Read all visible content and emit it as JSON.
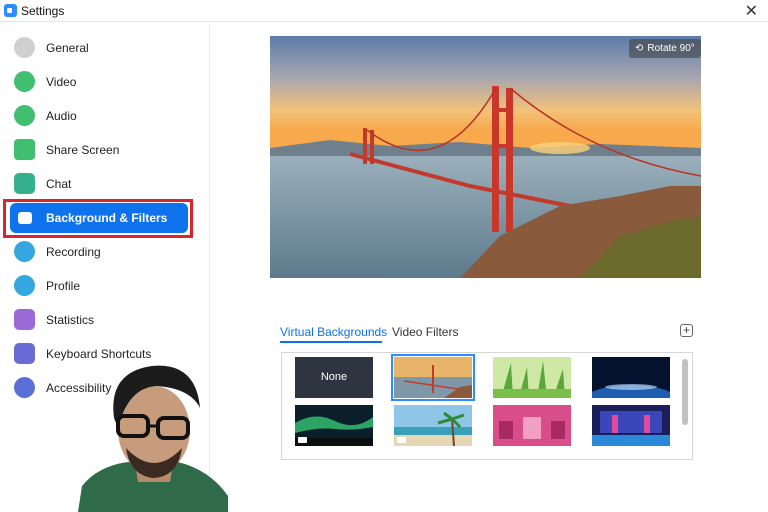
{
  "window": {
    "title": "Settings",
    "close_glyph": "✕"
  },
  "sidebar": {
    "items": [
      {
        "label": "General",
        "icon": "gear-icon",
        "color": "#c9c9c9"
      },
      {
        "label": "Video",
        "icon": "video-camera-icon",
        "color": "#3fbf6f"
      },
      {
        "label": "Audio",
        "icon": "headphones-icon",
        "color": "#3fbf6f"
      },
      {
        "label": "Share Screen",
        "icon": "share-screen-icon",
        "color": "#3fbf6f"
      },
      {
        "label": "Chat",
        "icon": "chat-icon",
        "color": "#34b08c"
      },
      {
        "label": "Background & Filters",
        "icon": "background-icon",
        "color": "#0e72ed",
        "active": true
      },
      {
        "label": "Recording",
        "icon": "record-icon",
        "color": "#35a7e0"
      },
      {
        "label": "Profile",
        "icon": "profile-icon",
        "color": "#35a7e0"
      },
      {
        "label": "Statistics",
        "icon": "statistics-icon",
        "color": "#9a6bd6"
      },
      {
        "label": "Keyboard Shortcuts",
        "icon": "keyboard-icon",
        "color": "#6b6bd6"
      },
      {
        "label": "Accessibility",
        "icon": "accessibility-icon",
        "color": "#5a6fd6"
      }
    ]
  },
  "preview": {
    "rotate_label": "Rotate 90°",
    "rotate_icon": "rotate-icon"
  },
  "tabs": {
    "virtual_backgrounds": "Virtual Backgrounds",
    "video_filters": "Video Filters",
    "add_icon": "plus-icon"
  },
  "backgrounds": {
    "none_label": "None",
    "items": [
      {
        "name": "none",
        "selected": false
      },
      {
        "name": "golden-gate-bridge",
        "selected": true
      },
      {
        "name": "grass",
        "selected": false
      },
      {
        "name": "earth-from-space",
        "selected": false
      },
      {
        "name": "aurora",
        "selected": false
      },
      {
        "name": "beach-palm",
        "selected": false
      },
      {
        "name": "pink-room",
        "selected": false
      },
      {
        "name": "stage",
        "selected": false
      }
    ]
  },
  "colors": {
    "accent": "#0e72ed",
    "highlight_outline": "#d7262f"
  }
}
